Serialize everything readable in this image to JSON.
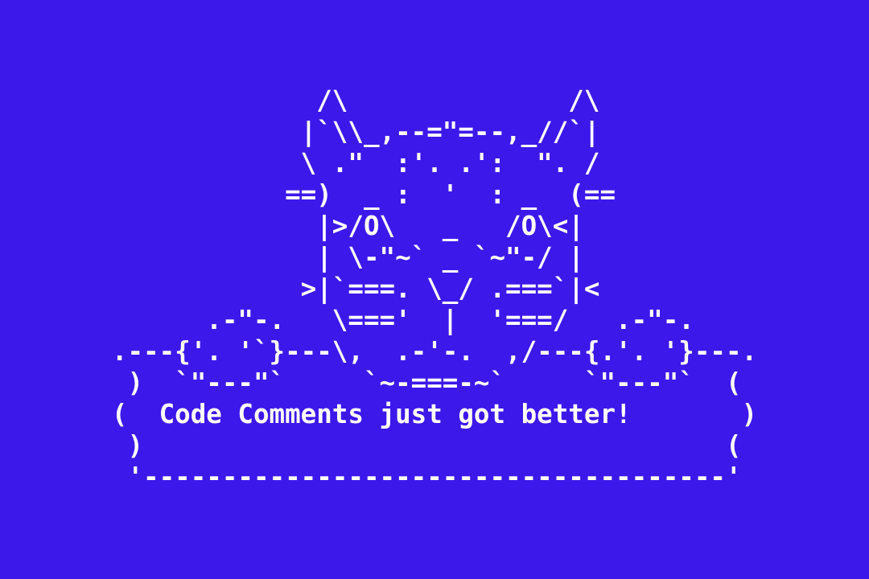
{
  "page": {
    "background_color": "#3d18eb",
    "text_color": "#ffffff",
    "ascii_lines": [
      "             /\\              /\\",
      "            |`\\\\_,--=\"=--,_//`|",
      "            \\ .\"  :'. .':  \". /",
      "           ==)  _ :  '  : _  (==",
      "             |>/O\\   _   /O\\<|",
      "             | \\-\"~` _ `~\"-/ |",
      "            >|`===. \\_/ .===`|<",
      "      .-\"-.   \\==='  |  '===/   .-\"-.",
      ".---{'. '`}---\\,  .-'-.  ,/---{.'. '}---.",
      " )  `\"---\"`     `~-===-~`     `\"---\"`  (",
      "(  Code Comments just got better!       )",
      " )                                     (",
      " '-------------------------------------'"
    ]
  }
}
